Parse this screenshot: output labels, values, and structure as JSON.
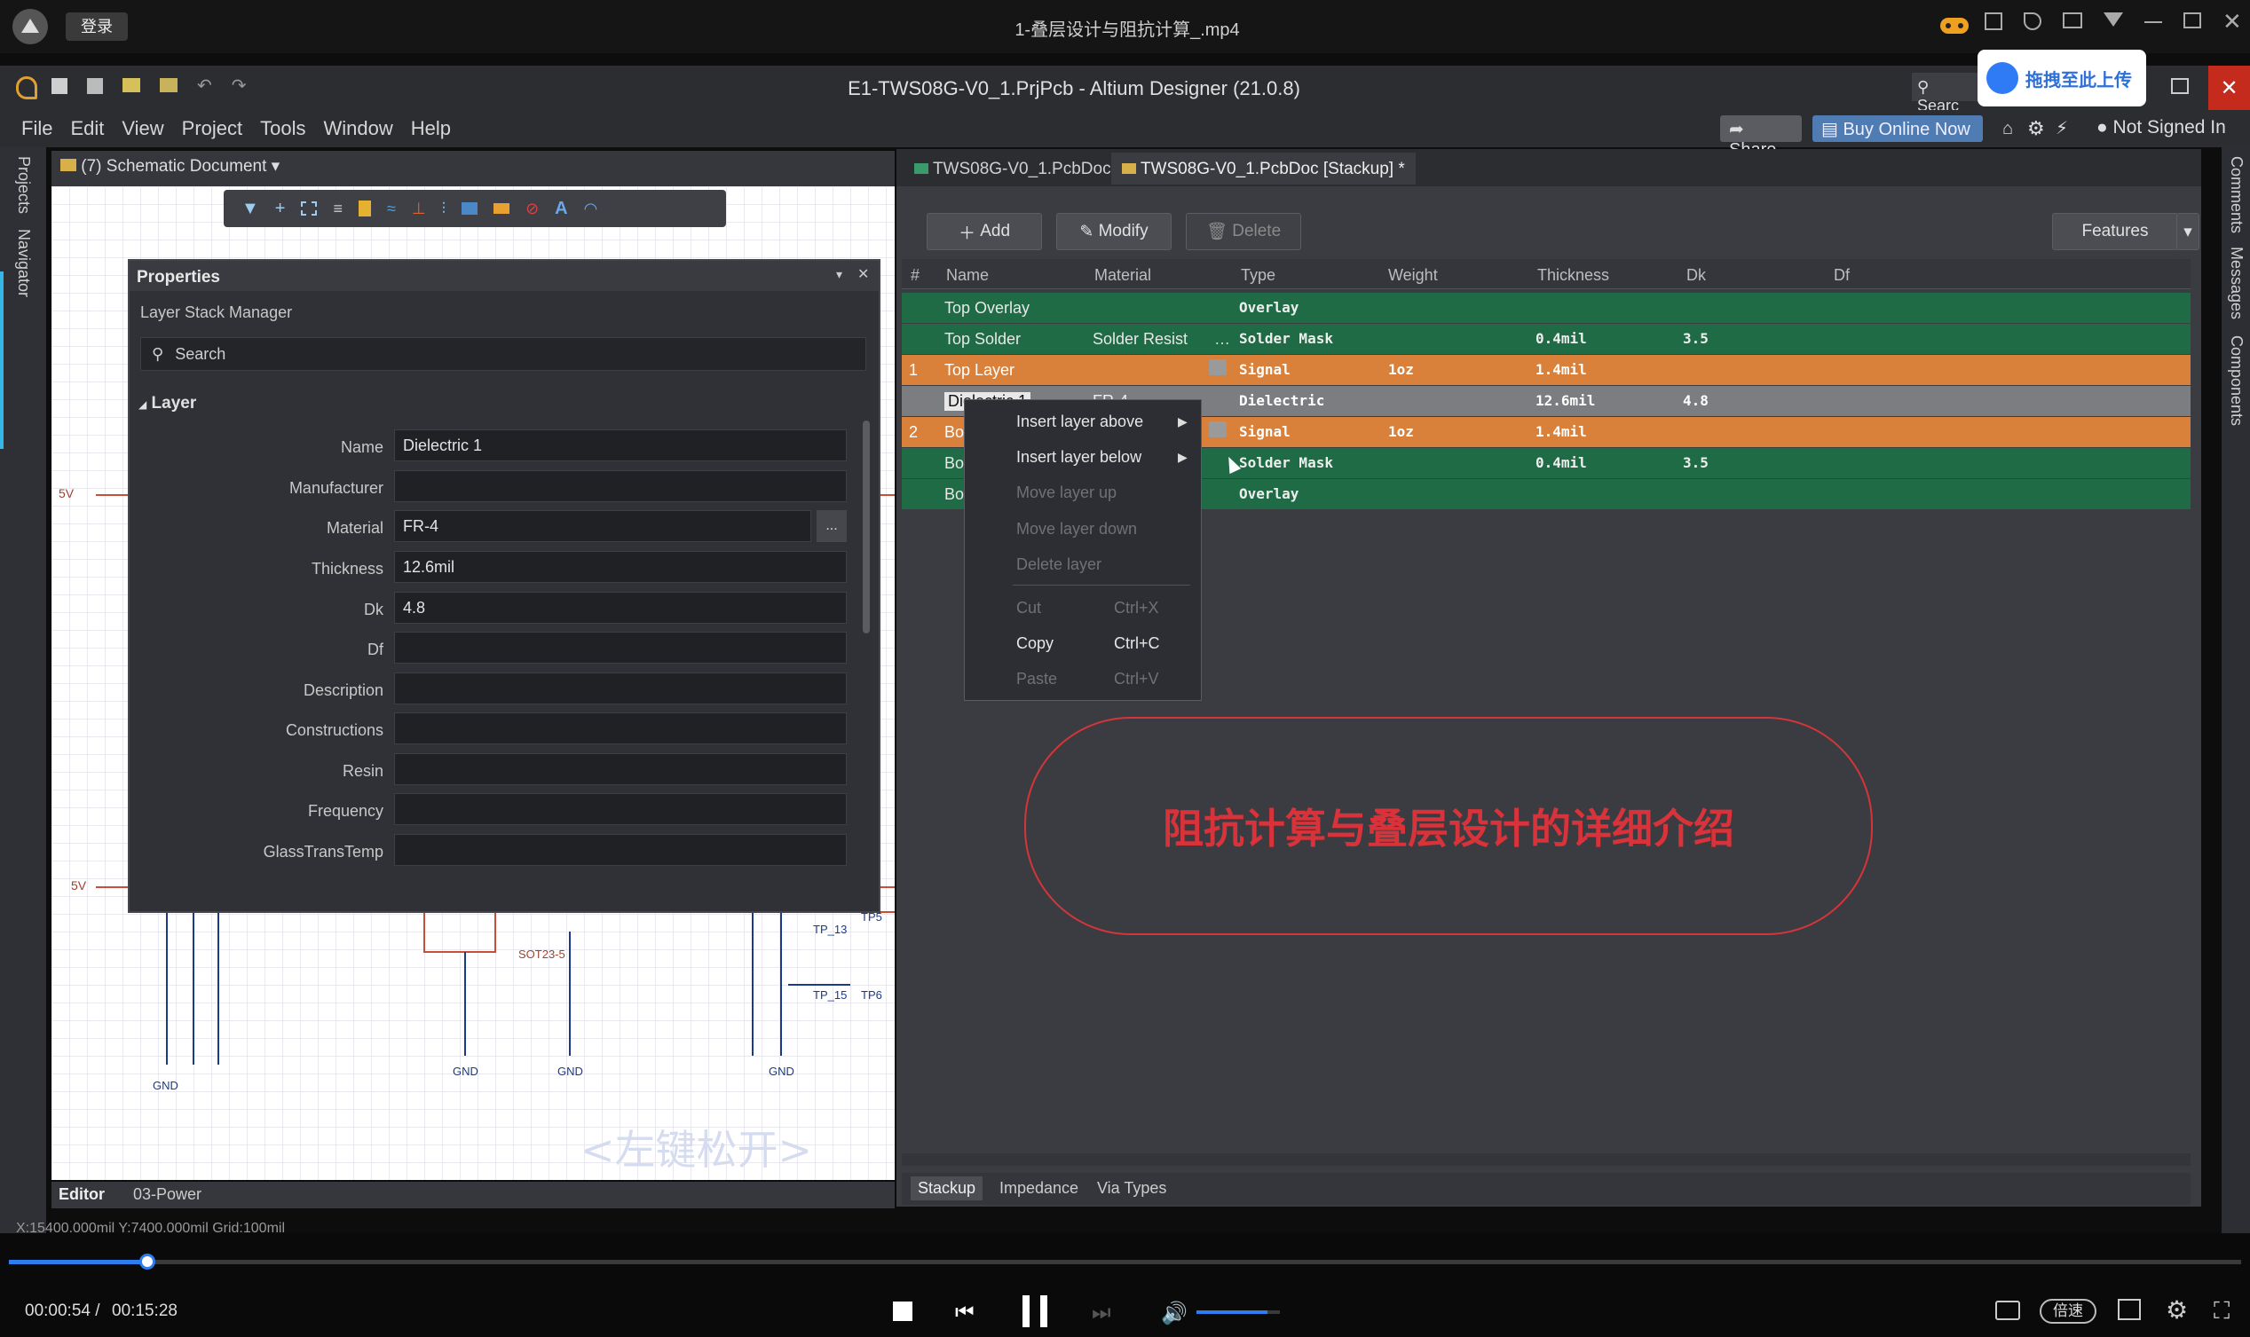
{
  "player": {
    "login": "登录",
    "video_title": "1-叠层设计与阻抗计算_.mp4",
    "time_current": "00:00:54 /",
    "time_total": "00:15:28",
    "speed_label": "倍速",
    "progress": 0.062,
    "volume": 0.85,
    "upload_label": "拖拽至此上传"
  },
  "app": {
    "title": "E1-TWS08G-V0_1.PrjPcb - Altium Designer (21.0.8)",
    "search_label": "Searc",
    "menu": [
      "File",
      "Edit",
      "View",
      "Project",
      "Tools",
      "Window",
      "Help"
    ],
    "share": "Share",
    "buy": "Buy Online Now",
    "signed": "Not Signed In"
  },
  "left_panel": {
    "side_tabs": [
      "Projects",
      "Navigator"
    ],
    "doc_selector": "(7) Schematic Document",
    "bottom_tabs": [
      "Editor",
      "03-Power"
    ],
    "status": "X:15400.000mil Y:7400.000mil   Grid:100mil"
  },
  "properties": {
    "title": "Properties",
    "subtitle": "Layer Stack Manager",
    "search_placeholder": "Search",
    "section": "Layer",
    "fields": [
      {
        "label": "Name",
        "value": "Dielectric 1"
      },
      {
        "label": "Manufacturer",
        "value": ""
      },
      {
        "label": "Material",
        "value": "FR-4"
      },
      {
        "label": "Thickness",
        "value": "12.6mil"
      },
      {
        "label": "Dk",
        "value": "4.8"
      },
      {
        "label": "Df",
        "value": ""
      },
      {
        "label": "Description",
        "value": ""
      },
      {
        "label": "Constructions",
        "value": ""
      },
      {
        "label": "Resin",
        "value": ""
      },
      {
        "label": "Frequency",
        "value": ""
      },
      {
        "label": "GlassTransTemp",
        "value": ""
      }
    ],
    "ellipsis": "..."
  },
  "doc_tabs": [
    "TWS08G-V0_1.PcbDoc *",
    "TWS08G-V0_1.PcbDoc [Stackup] *"
  ],
  "toolbar": {
    "add": "Add",
    "modify": "Modify",
    "delete": "Delete",
    "features": "Features"
  },
  "table": {
    "headers": [
      "#",
      "Name",
      "Material",
      "Type",
      "Weight",
      "Thickness",
      "Dk",
      "Df"
    ],
    "rows": [
      {
        "num": "",
        "name": "Top Overlay",
        "material": "",
        "type": "Overlay",
        "weight": "",
        "thickness": "",
        "dk": "",
        "style": "green"
      },
      {
        "num": "",
        "name": "Top Solder",
        "material": "Solder Resist",
        "type": "Solder Mask",
        "weight": "",
        "thickness": "0.4mil",
        "dk": "3.5",
        "style": "green"
      },
      {
        "num": "1",
        "name": "Top Layer",
        "material": "",
        "type": "Signal",
        "weight": "1oz",
        "thickness": "1.4mil",
        "dk": "",
        "style": "orange"
      },
      {
        "num": "",
        "name": "Dielectric 1",
        "material": "FR-4",
        "type": "Dielectric",
        "weight": "",
        "thickness": "12.6mil",
        "dk": "4.8",
        "style": "grey"
      },
      {
        "num": "2",
        "name": "Bo",
        "material": "",
        "type": "Signal",
        "weight": "1oz",
        "thickness": "1.4mil",
        "dk": "",
        "style": "orange"
      },
      {
        "num": "",
        "name": "Bo",
        "material": "",
        "type": "Solder Mask",
        "weight": "",
        "thickness": "0.4mil",
        "dk": "3.5",
        "style": "green"
      },
      {
        "num": "",
        "name": "Bo",
        "material": "",
        "type": "Overlay",
        "weight": "",
        "thickness": "",
        "dk": "",
        "style": "green"
      }
    ]
  },
  "context_menu": [
    {
      "label": "Insert layer above",
      "shortcut": "",
      "enabled": true,
      "submenu": true
    },
    {
      "label": "Insert layer below",
      "shortcut": "",
      "enabled": true,
      "submenu": true
    },
    {
      "label": "Move layer up",
      "shortcut": "",
      "enabled": false,
      "submenu": false
    },
    {
      "label": "Move layer down",
      "shortcut": "",
      "enabled": false,
      "submenu": false
    },
    {
      "label": "Delete layer",
      "shortcut": "",
      "enabled": false,
      "submenu": false
    },
    {
      "label": "Cut",
      "shortcut": "Ctrl+X",
      "enabled": false,
      "submenu": false
    },
    {
      "label": "Copy",
      "shortcut": "Ctrl+C",
      "enabled": true,
      "submenu": false
    },
    {
      "label": "Paste",
      "shortcut": "Ctrl+V",
      "enabled": false,
      "submenu": false
    }
  ],
  "bottom_tabs": [
    "Stackup",
    "Impedance",
    "Via Types"
  ],
  "right_side_tabs": [
    "Comments",
    "Messages",
    "Components"
  ],
  "overlay_text": "阻抗计算与叠层设计的详细介绍",
  "watermark": "<左键松开>",
  "schematic_labels": {
    "net1": "5V",
    "net2": "5V",
    "gnd": "GND",
    "sot": "SOT23-5",
    "tp1": "TP_13",
    "tp2": "TP_15",
    "tp3": "TP6",
    "tp4": "TP5"
  }
}
